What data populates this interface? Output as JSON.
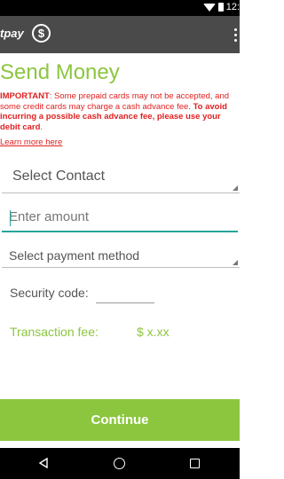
{
  "status": {
    "time": "12:"
  },
  "app_bar": {
    "brand": "tpay"
  },
  "page": {
    "title": "Send Money",
    "warning_important": "IMPORTANT",
    "warning_body": ": Some prepaid cards may not be accepted, and some credit cards may charge a cash advance fee. ",
    "warning_bold": "To avoid incurring a possible cash advance fee, please use your debit card",
    "warning_end": ".",
    "learn_more": "Learn more here"
  },
  "form": {
    "contact_placeholder": "Select Contact",
    "amount_placeholder": "Enter amount",
    "payment_placeholder": "Select payment method",
    "security_label": "Security code:",
    "security_value": "",
    "fee_label": "Transaction fee:",
    "fee_value": "$ x.xx"
  },
  "actions": {
    "continue_label": "Continue"
  },
  "colors": {
    "accent_green": "#8cc63f",
    "warning_red": "#e02020",
    "app_bar": "#4a4a4a",
    "input_focus": "#26a69a"
  },
  "icons": [
    "wifi-icon",
    "battery-icon",
    "dollar-circle-icon",
    "overflow-menu-icon",
    "dropdown-corner-icon",
    "back-icon",
    "home-icon",
    "recents-icon"
  ]
}
